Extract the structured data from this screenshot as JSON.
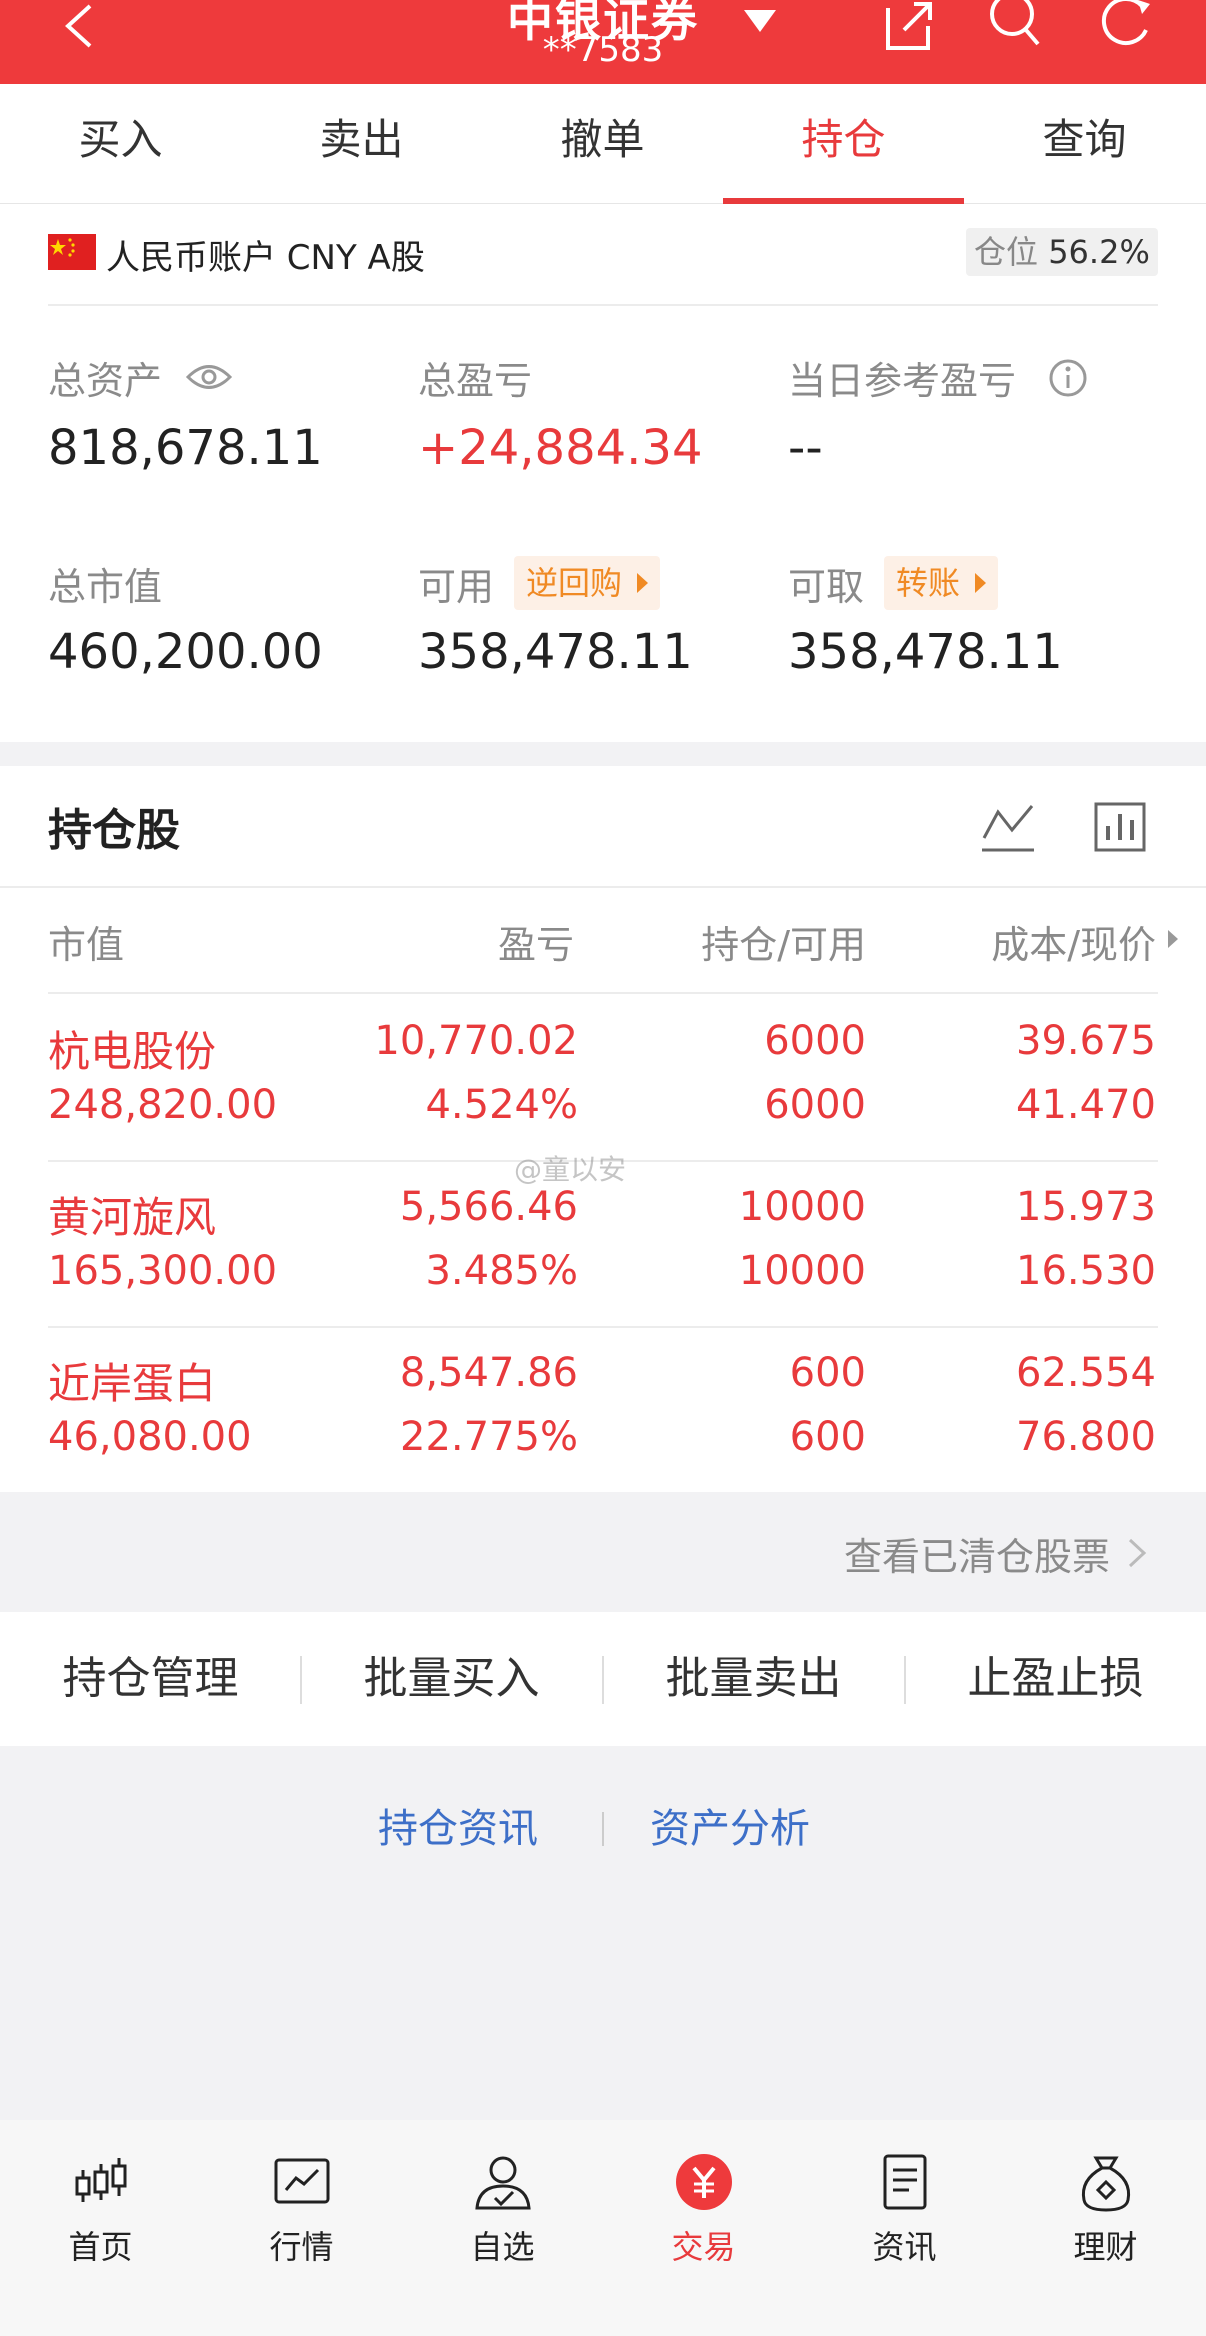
{
  "header": {
    "title": "中银证券",
    "account": "**7583",
    "theme_color": "#ee3a3c"
  },
  "tabs": [
    {
      "label": "买入"
    },
    {
      "label": "卖出"
    },
    {
      "label": "撤单"
    },
    {
      "label": "持仓",
      "active": true
    },
    {
      "label": "查询"
    }
  ],
  "summary": {
    "account_label": "人民币账户 CNY A股",
    "position_label": "仓位",
    "position_value": "56.2%",
    "total_assets_label": "总资产",
    "total_assets": "818,678.11",
    "total_pl_label": "总盈亏",
    "total_pl": "+24,884.34",
    "day_pl_label": "当日参考盈亏",
    "day_pl": "--",
    "market_value_label": "总市值",
    "market_value": "460,200.00",
    "available_label": "可用",
    "available": "358,478.11",
    "repo_chip": "逆回购",
    "withdrawable_label": "可取",
    "withdrawable": "358,478.11",
    "transfer_chip": "转账"
  },
  "holdings": {
    "title": "持仓股",
    "columns": [
      "市值",
      "盈亏",
      "持仓/可用",
      "成本/现价"
    ],
    "rows": [
      {
        "name": "杭电股份",
        "market_value": "248,820.00",
        "pl": "10,770.02",
        "pl_pct": "4.524%",
        "position": "6000",
        "available": "6000",
        "cost": "39.675",
        "price": "41.470"
      },
      {
        "name": "黄河旋风",
        "market_value": "165,300.00",
        "pl": "5,566.46",
        "pl_pct": "3.485%",
        "position": "10000",
        "available": "10000",
        "cost": "15.973",
        "price": "16.530"
      },
      {
        "name": "近岸蛋白",
        "market_value": "46,080.00",
        "pl": "8,547.86",
        "pl_pct": "22.775%",
        "position": "600",
        "available": "600",
        "cost": "62.554",
        "price": "76.800"
      }
    ],
    "cleared_link": "查看已清仓股票"
  },
  "watermark": "@童以安",
  "actions": [
    "持仓管理",
    "批量买入",
    "批量卖出",
    "止盈止损"
  ],
  "links": [
    "持仓资讯",
    "资产分析"
  ],
  "nav": [
    {
      "label": "首页",
      "icon": "candlestick-icon"
    },
    {
      "label": "行情",
      "icon": "market-chart-icon"
    },
    {
      "label": "自选",
      "icon": "user-check-icon"
    },
    {
      "label": "交易",
      "icon": "yuan-icon",
      "active": true
    },
    {
      "label": "资讯",
      "icon": "document-icon"
    },
    {
      "label": "理财",
      "icon": "money-bag-icon"
    }
  ]
}
